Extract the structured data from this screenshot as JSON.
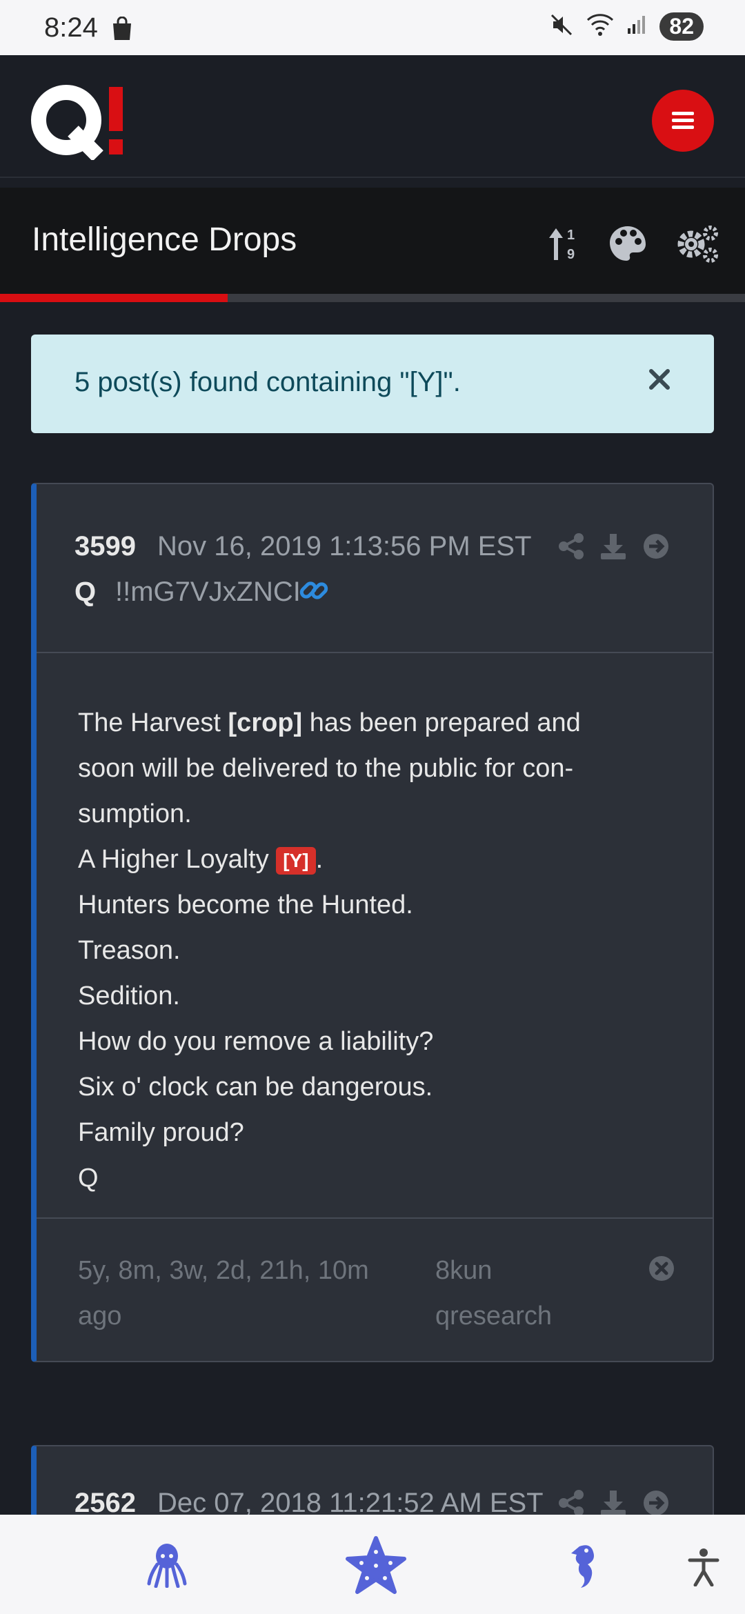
{
  "status_bar": {
    "time": "8:24",
    "battery": "82",
    "icons": [
      "shopping-bag-icon",
      "mute-icon",
      "wifi-icon",
      "signal-icon"
    ]
  },
  "header": {
    "logo_text": "Q!",
    "menu_icon": "hamburger-menu-icon"
  },
  "title_bar": {
    "title": "Intelligence Drops",
    "icons": [
      "sort-numeric-icon",
      "palette-icon",
      "settings-gears-icon"
    ],
    "progress_fraction": 0.306
  },
  "alert": {
    "text": "5 post(s) found containing \"[Y]\".",
    "close_icon": "close-icon"
  },
  "posts": [
    {
      "number": "3599",
      "date": "Nov 16, 2019 1:13:56 PM EST",
      "author": "Q",
      "tripcode": "!!mG7VJxZNCI",
      "body": {
        "l1_pre": "The Harvest ",
        "l1_bold": "[crop]",
        "l1_post": " has been prepared and",
        "l2": "soon will be delivered to the public for con-",
        "l3": "sumption.",
        "l4_pre": "A Higher Loyalty ",
        "l4_tag": "[Y]",
        "l4_post": ".",
        "l5": "Hunters become the Hunted.",
        "l6": "Treason.",
        "l7": "Sedition.",
        "l8": "How do you remove a liability?",
        "l9": "Six o' clock can be dangerous.",
        "l10": "Family proud?",
        "l11": "Q"
      },
      "ago_line1": "5y, 8m, 3w, 2d, 21h, 10m",
      "ago_line2": "ago",
      "source_line1": "8kun",
      "source_line2": "qresearch"
    },
    {
      "number": "2562",
      "date": "Dec 07, 2018 11:21:52 AM EST"
    }
  ],
  "bottom_nav": {
    "items": [
      "octopus-icon",
      "starfish-icon",
      "seahorse-icon",
      "accessibility-icon"
    ]
  },
  "colors": {
    "accent_red": "#d90f13",
    "brand_blue": "#1d5fb8",
    "nav_icon": "#5563d8"
  }
}
